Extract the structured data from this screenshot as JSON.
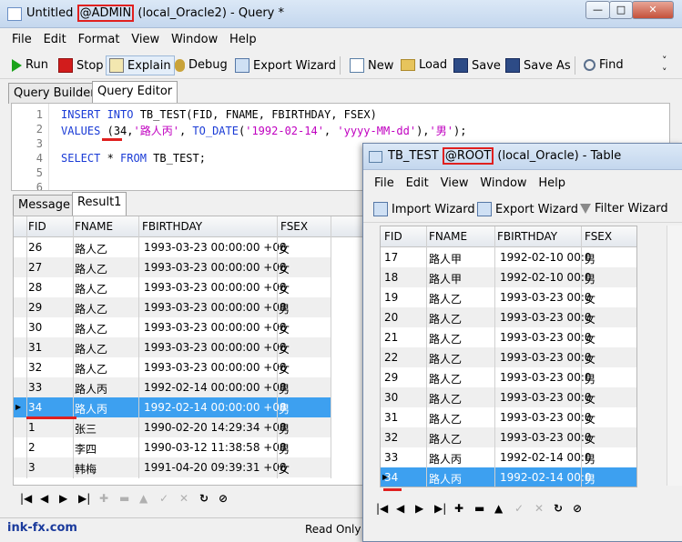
{
  "main_window": {
    "title_prefix": "Untitled ",
    "title_user": "@ADMIN",
    "title_suffix": " (local_Oracle2) - Query *",
    "menu": [
      "File",
      "Edit",
      "Format",
      "View",
      "Window",
      "Help"
    ],
    "toolbar": {
      "run": "Run",
      "stop": "Stop",
      "explain": "Explain",
      "debug": "Debug",
      "export_wizard": "Export Wizard",
      "new": "New",
      "load": "Load",
      "save": "Save",
      "save_as": "Save As",
      "find": "Find"
    },
    "tabs": [
      "Query Builder",
      "Query Editor"
    ],
    "editor_lines": [
      "1",
      "2",
      "3",
      "4",
      "5",
      "6"
    ],
    "code": {
      "l1_kw1": "INSERT INTO",
      "l1_rest": " TB_TEST(FID, FNAME, FBIRTHDAY, FSEX)",
      "l2_kw": "VALUES",
      "l2_a": " (",
      "l2_num": "34",
      "l2_b": ",",
      "l2_str1": "'路人丙'",
      "l2_c": ", ",
      "l2_fn": "TO_DATE",
      "l2_d": "(",
      "l2_str2": "'1992-02-14'",
      "l2_e": ", ",
      "l2_str3": "'yyyy-MM-dd'",
      "l2_f": "),",
      "l2_str4": "'男'",
      "l2_g": ");",
      "l4_kw1": "SELECT",
      "l4_b": " * ",
      "l4_kw2": "FROM",
      "l4_rest": " TB_TEST;"
    },
    "result_tabs": [
      "Message",
      "Result1"
    ],
    "columns": [
      "FID",
      "FNAME",
      "FBIRTHDAY",
      "FSEX"
    ],
    "rows": [
      [
        "26",
        "路人乙",
        "1993-03-23 00:00:00 +08",
        "女"
      ],
      [
        "27",
        "路人乙",
        "1993-03-23 00:00:00 +08",
        "女"
      ],
      [
        "28",
        "路人乙",
        "1993-03-23 00:00:00 +08",
        "女"
      ],
      [
        "29",
        "路人乙",
        "1993-03-23 00:00:00 +08",
        "男"
      ],
      [
        "30",
        "路人乙",
        "1993-03-23 00:00:00 +08",
        "女"
      ],
      [
        "31",
        "路人乙",
        "1993-03-23 00:00:00 +08",
        "女"
      ],
      [
        "32",
        "路人乙",
        "1993-03-23 00:00:00 +08",
        "女"
      ],
      [
        "33",
        "路人丙",
        "1992-02-14 00:00:00 +08",
        "男"
      ],
      [
        "34",
        "路人丙",
        "1992-02-14 00:00:00 +08",
        "男"
      ],
      [
        "1",
        "张三",
        "1990-02-20 14:29:34 +08",
        "男"
      ],
      [
        "2",
        "李四",
        "1990-03-12 11:38:58 +08",
        "男"
      ],
      [
        "3",
        "韩梅",
        "1991-04-20 09:39:31 +08",
        "女"
      ]
    ],
    "selected_row": 8,
    "status": {
      "left": "ink-fx.com",
      "right": "Read Only"
    }
  },
  "table_window": {
    "title_prefix": "TB_TEST ",
    "title_user": "@ROOT",
    "title_suffix": " (local_Oracle) - Table",
    "menu": [
      "File",
      "Edit",
      "View",
      "Window",
      "Help"
    ],
    "toolbar": {
      "import_wizard": "Import Wizard",
      "export_wizard": "Export Wizard",
      "filter_wizard": "Filter Wizard"
    },
    "columns": [
      "FID",
      "FNAME",
      "FBIRTHDAY",
      "FSEX"
    ],
    "rows": [
      [
        "17",
        "路人甲",
        "1992-02-10 00:0",
        "男"
      ],
      [
        "18",
        "路人甲",
        "1992-02-10 00:0",
        "男"
      ],
      [
        "19",
        "路人乙",
        "1993-03-23 00:0",
        "女"
      ],
      [
        "20",
        "路人乙",
        "1993-03-23 00:0",
        "女"
      ],
      [
        "21",
        "路人乙",
        "1993-03-23 00:0",
        "女"
      ],
      [
        "22",
        "路人乙",
        "1993-03-23 00:0",
        "女"
      ],
      [
        "29",
        "路人乙",
        "1993-03-23 00:0",
        "男"
      ],
      [
        "30",
        "路人乙",
        "1993-03-23 00:0",
        "女"
      ],
      [
        "31",
        "路人乙",
        "1993-03-23 00:0",
        "女"
      ],
      [
        "32",
        "路人乙",
        "1993-03-23 00:0",
        "女"
      ],
      [
        "33",
        "路人丙",
        "1992-02-14 00:0",
        "男"
      ],
      [
        "34",
        "路人丙",
        "1992-02-14 00:0",
        "男"
      ]
    ],
    "selected_row": 11
  },
  "colors": {
    "selection": "#3da0f0",
    "highlight": "#e0201f",
    "keyword": "#1a3bd6",
    "string": "#c000c0"
  },
  "icons": [
    "run-icon",
    "stop-icon",
    "explain-icon",
    "debug-icon",
    "export-icon",
    "new-icon",
    "load-icon",
    "save-icon",
    "save-as-icon",
    "find-icon",
    "import-icon",
    "filter-icon"
  ]
}
